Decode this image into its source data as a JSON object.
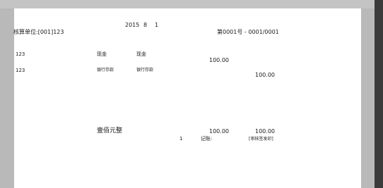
{
  "header": {
    "date_year": "2015",
    "date_month": "8",
    "date_day": "1",
    "unit_label": "核算单位:[001]123",
    "voucher_number": "第0001号 - 0001/0001"
  },
  "entries": [
    {
      "summary": "123",
      "account_code": "现金",
      "account_name": "现金",
      "debit": "100.00",
      "credit": ""
    },
    {
      "summary": "123",
      "account_code": "银行存款",
      "account_name": "银行存款",
      "debit": "",
      "credit": "100.00"
    }
  ],
  "footer": {
    "amount_words": "壹佰元整",
    "debit_total": "100.00",
    "credit_total": "100.00",
    "attachments": "1",
    "bookkeeper_label": "记账:",
    "reviewer_label": "[审核签发印]"
  }
}
